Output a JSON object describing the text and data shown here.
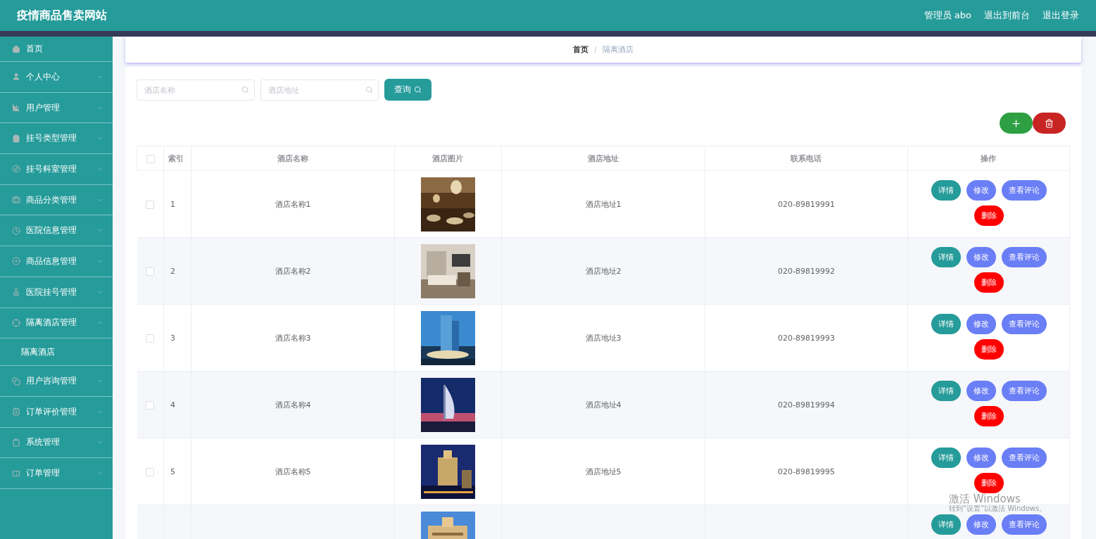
{
  "header": {
    "title": "疫情商品售卖网站",
    "user": "管理员 abo",
    "links": [
      "退出到前台",
      "退出登录"
    ]
  },
  "sidebar": {
    "items": [
      {
        "label": "首页",
        "kind": "link"
      },
      {
        "label": "个人中心",
        "kind": "menu",
        "expanded": false
      },
      {
        "label": "用户管理",
        "kind": "menu",
        "expanded": false
      },
      {
        "label": "挂号类型管理",
        "kind": "menu",
        "expanded": false
      },
      {
        "label": "挂号科室管理",
        "kind": "menu",
        "expanded": false
      },
      {
        "label": "商品分类管理",
        "kind": "menu",
        "expanded": false
      },
      {
        "label": "医院信息管理",
        "kind": "menu",
        "expanded": false
      },
      {
        "label": "商品信息管理",
        "kind": "menu",
        "expanded": false
      },
      {
        "label": "医院挂号管理",
        "kind": "menu",
        "expanded": false
      },
      {
        "label": "隔离酒店管理",
        "kind": "menu",
        "expanded": true,
        "children": [
          {
            "label": "隔离酒店"
          }
        ]
      },
      {
        "label": "用户咨询管理",
        "kind": "menu",
        "expanded": false
      },
      {
        "label": "订单评价管理",
        "kind": "menu",
        "expanded": false
      },
      {
        "label": "系统管理",
        "kind": "menu",
        "expanded": false
      },
      {
        "label": "订单管理",
        "kind": "menu",
        "expanded": false
      }
    ]
  },
  "breadcrumb": [
    "首页",
    "隔离酒店"
  ],
  "breadcrumb_separator": "/",
  "search": {
    "fields": [
      {
        "placeholder": "酒店名称"
      },
      {
        "placeholder": "酒店地址"
      }
    ],
    "button": "查询"
  },
  "table": {
    "columns": [
      "索引",
      "酒店名称",
      "酒店图片",
      "酒店地址",
      "联系电话",
      "操作"
    ],
    "header_checked": false,
    "rows": [
      {
        "checked": false,
        "index": "1",
        "name": "酒店名称1",
        "picture": {
          "kind": "picture"
        },
        "address": "酒店地址1",
        "phone": "020-89819991",
        "actions": [
          {
            "label": "详情",
            "kind": "detail"
          },
          {
            "label": "修改",
            "kind": "edit"
          },
          {
            "label": "查看评论",
            "kind": "reviews"
          },
          {
            "label": "删除",
            "kind": "delete"
          }
        ]
      },
      {
        "checked": false,
        "index": "2",
        "name": "酒店名称2",
        "picture": {
          "kind": "picture"
        },
        "address": "酒店地址2",
        "phone": "020-89819992",
        "actions": [
          {
            "label": "详情",
            "kind": "detail"
          },
          {
            "label": "修改",
            "kind": "edit"
          },
          {
            "label": "查看评论",
            "kind": "reviews"
          },
          {
            "label": "删除",
            "kind": "delete"
          }
        ]
      },
      {
        "checked": false,
        "index": "3",
        "name": "酒店名称3",
        "picture": {
          "kind": "picture"
        },
        "address": "酒店地址3",
        "phone": "020-89819993",
        "actions": [
          {
            "label": "详情",
            "kind": "detail"
          },
          {
            "label": "修改",
            "kind": "edit"
          },
          {
            "label": "查看评论",
            "kind": "reviews"
          },
          {
            "label": "删除",
            "kind": "delete"
          }
        ]
      },
      {
        "checked": false,
        "index": "4",
        "name": "酒店名称4",
        "picture": {
          "kind": "picture"
        },
        "address": "酒店地址4",
        "phone": "020-89819994",
        "actions": [
          {
            "label": "详情",
            "kind": "detail"
          },
          {
            "label": "修改",
            "kind": "edit"
          },
          {
            "label": "查看评论",
            "kind": "reviews"
          },
          {
            "label": "删除",
            "kind": "delete"
          }
        ]
      },
      {
        "checked": false,
        "index": "5",
        "name": "酒店名称5",
        "picture": {
          "kind": "picture"
        },
        "address": "酒店地址5",
        "phone": "020-89819995",
        "actions": [
          {
            "label": "详情",
            "kind": "detail"
          },
          {
            "label": "修改",
            "kind": "edit"
          },
          {
            "label": "查看评论",
            "kind": "reviews"
          },
          {
            "label": "删除",
            "kind": "delete"
          }
        ]
      },
      {
        "picture": {
          "kind": "picture"
        },
        "actions": [
          {
            "label": "详情",
            "kind": "detail"
          },
          {
            "label": "修改",
            "kind": "edit"
          },
          {
            "label": "查看评论",
            "kind": "reviews"
          }
        ]
      }
    ]
  },
  "activation_notice": {
    "title": "激活 Windows",
    "text": "转到“设置”以激活 Windows。"
  }
}
